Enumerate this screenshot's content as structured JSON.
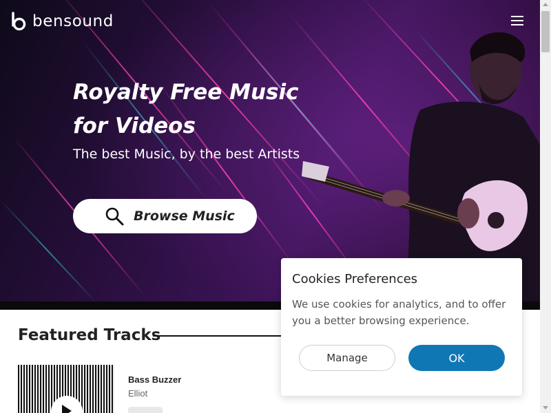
{
  "header": {
    "brand": "bensound",
    "menu_icon": "hamburger-menu-icon"
  },
  "hero": {
    "title_line1": "Royalty Free Music",
    "title_line2": "for Videos",
    "subtitle": "The best Music, by the best Artists",
    "browse_label": "Browse Music",
    "browse_icon": "search-icon"
  },
  "featured": {
    "title": "Featured Tracks",
    "tracks": [
      {
        "name": "Bass Buzzer",
        "artist": "Elliot"
      }
    ]
  },
  "cookie_dialog": {
    "title": "Cookies Preferences",
    "text": "We use cookies for analytics, and to offer you a better browsing experience.",
    "manage_label": "Manage",
    "ok_label": "OK"
  },
  "colors": {
    "accent_blue": "#1077b5",
    "hero_purple": "#3d1458"
  }
}
